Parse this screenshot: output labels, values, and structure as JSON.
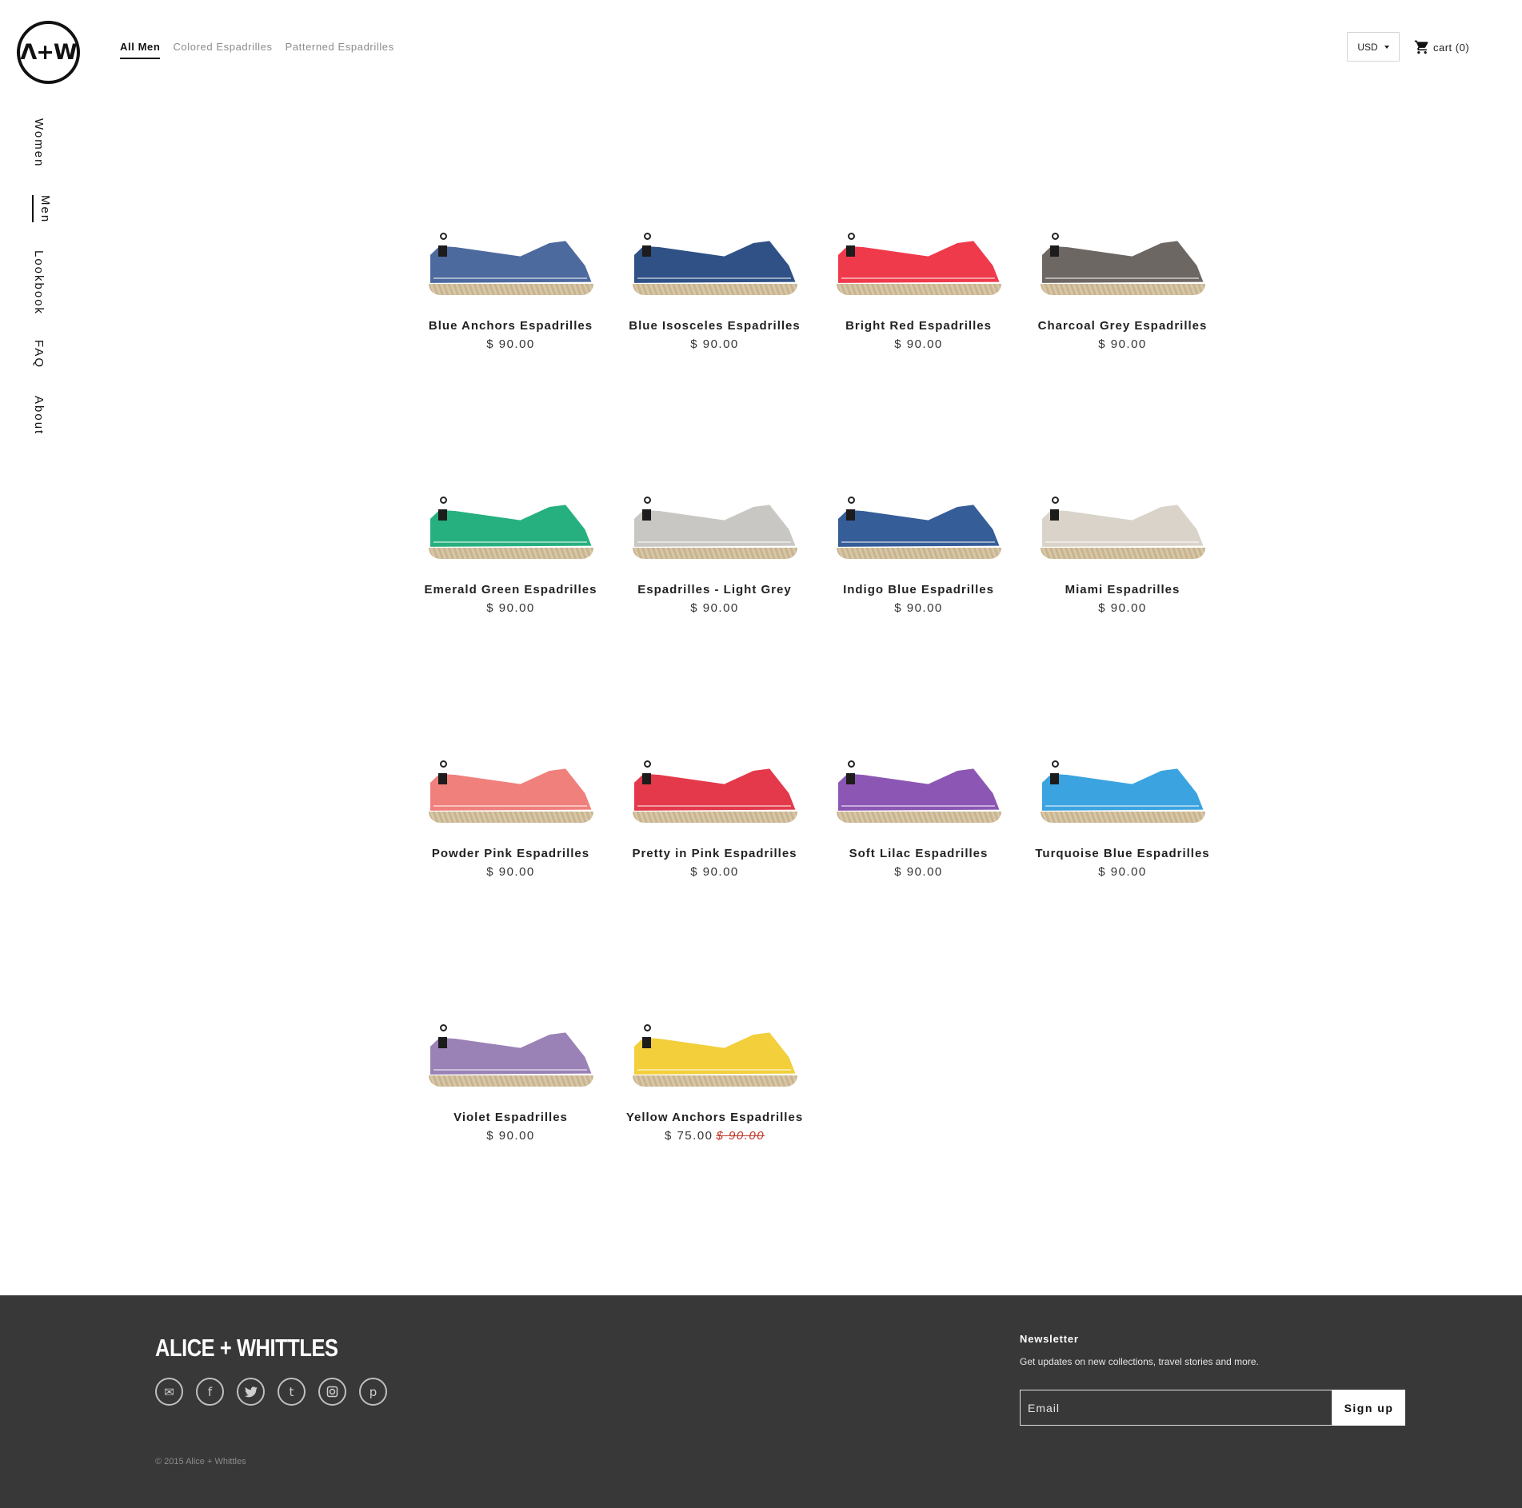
{
  "brand": {
    "logo_text": "Λ+W",
    "wordmark": "ALICE + WHITTLES"
  },
  "top_nav": [
    {
      "label": "All Men",
      "active": true
    },
    {
      "label": "Colored Espadrilles",
      "active": false
    },
    {
      "label": "Patterned Espadrilles",
      "active": false
    }
  ],
  "currency": {
    "selected": "USD"
  },
  "cart": {
    "label": "cart (0)"
  },
  "side_nav": [
    {
      "label": "Women",
      "active": false
    },
    {
      "label": "Men",
      "active": true
    },
    {
      "label": "Lookbook",
      "active": false
    },
    {
      "label": "FAQ",
      "active": false
    },
    {
      "label": "About",
      "active": false
    }
  ],
  "products": [
    {
      "name": "Blue Anchors Espadrilles",
      "price": "$ 90.00",
      "color": "#4d6a9f"
    },
    {
      "name": "Blue Isosceles Espadrilles",
      "price": "$ 90.00",
      "color": "#2f5186"
    },
    {
      "name": "Bright Red Espadrilles",
      "price": "$ 90.00",
      "color": "#ef3a4c"
    },
    {
      "name": "Charcoal Grey Espadrilles",
      "price": "$ 90.00",
      "color": "#6d6764"
    },
    {
      "name": "Emerald Green Espadrilles",
      "price": "$ 90.00",
      "color": "#27b07f"
    },
    {
      "name": "Espadrilles - Light Grey",
      "price": "$ 90.00",
      "color": "#c9c7c3"
    },
    {
      "name": "Indigo Blue Espadrilles",
      "price": "$ 90.00",
      "color": "#355d98"
    },
    {
      "name": "Miami Espadrilles",
      "price": "$ 90.00",
      "color": "#d9d3ca"
    },
    {
      "name": "Powder Pink Espadrilles",
      "price": "$ 90.00",
      "color": "#f0807c"
    },
    {
      "name": "Pretty in Pink Espadrilles",
      "price": "$ 90.00",
      "color": "#e3394a"
    },
    {
      "name": "Soft Lilac Espadrilles",
      "price": "$ 90.00",
      "color": "#8c57b4"
    },
    {
      "name": "Turquoise Blue Espadrilles",
      "price": "$ 90.00",
      "color": "#3aa3e0"
    },
    {
      "name": "Violet Espadrilles",
      "price": "$ 90.00",
      "color": "#9b82b6"
    },
    {
      "name": "Yellow Anchors Espadrilles",
      "price": "$ 75.00",
      "compare_price": "$ 90.00",
      "color": "#f2cf3b"
    }
  ],
  "footer": {
    "social_icons": [
      "email-icon",
      "facebook-icon",
      "twitter-icon",
      "tumblr-icon",
      "instagram-icon",
      "pinterest-icon"
    ],
    "copyright": "© 2015 Alice + Whittles",
    "newsletter": {
      "title": "Newsletter",
      "description": "Get updates on new collections, travel stories and more.",
      "placeholder": "Email",
      "button": "Sign up"
    }
  },
  "colors": {
    "footer_bg": "#383838",
    "sale_price": "#c0392b"
  }
}
